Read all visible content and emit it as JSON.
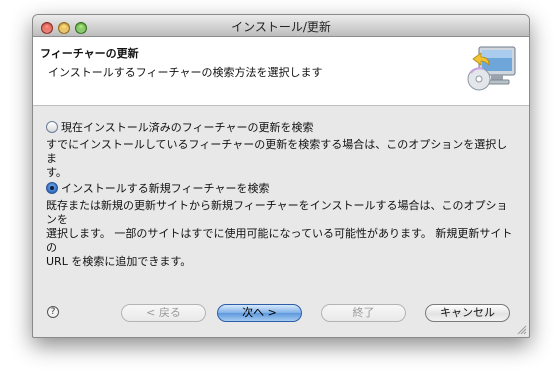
{
  "window": {
    "title": "インストール/更新"
  },
  "header": {
    "title": "フィーチャーの更新",
    "description": "インストールするフィーチャーの検索方法を選択します",
    "icon": "install-wizard-icon"
  },
  "options": [
    {
      "label": "現在インストール済みのフィーチャーの更新を検索",
      "selected": false,
      "description_lines": [
        "すでにインストールしているフィーチャーの更新を検索する場合は、このオプションを選択しま",
        "す。"
      ]
    },
    {
      "label": "インストールする新規フィーチャーを検索",
      "selected": true,
      "description_lines": [
        "既存または新規の更新サイトから新規フィーチャーをインストールする場合は、このオプションを",
        "選択します。 一部のサイトはすでに使用可能になっている可能性があります。 新規更新サイトの",
        "URL を検索に追加できます。"
      ]
    }
  ],
  "buttons": {
    "help": "?",
    "back": "< 戻る",
    "next": "次へ >",
    "finish": "終了",
    "cancel": "キャンセル"
  },
  "colors": {
    "accent": "#5e98de",
    "window_bg": "#e8e8e8",
    "header_bg": "#ffffff"
  }
}
